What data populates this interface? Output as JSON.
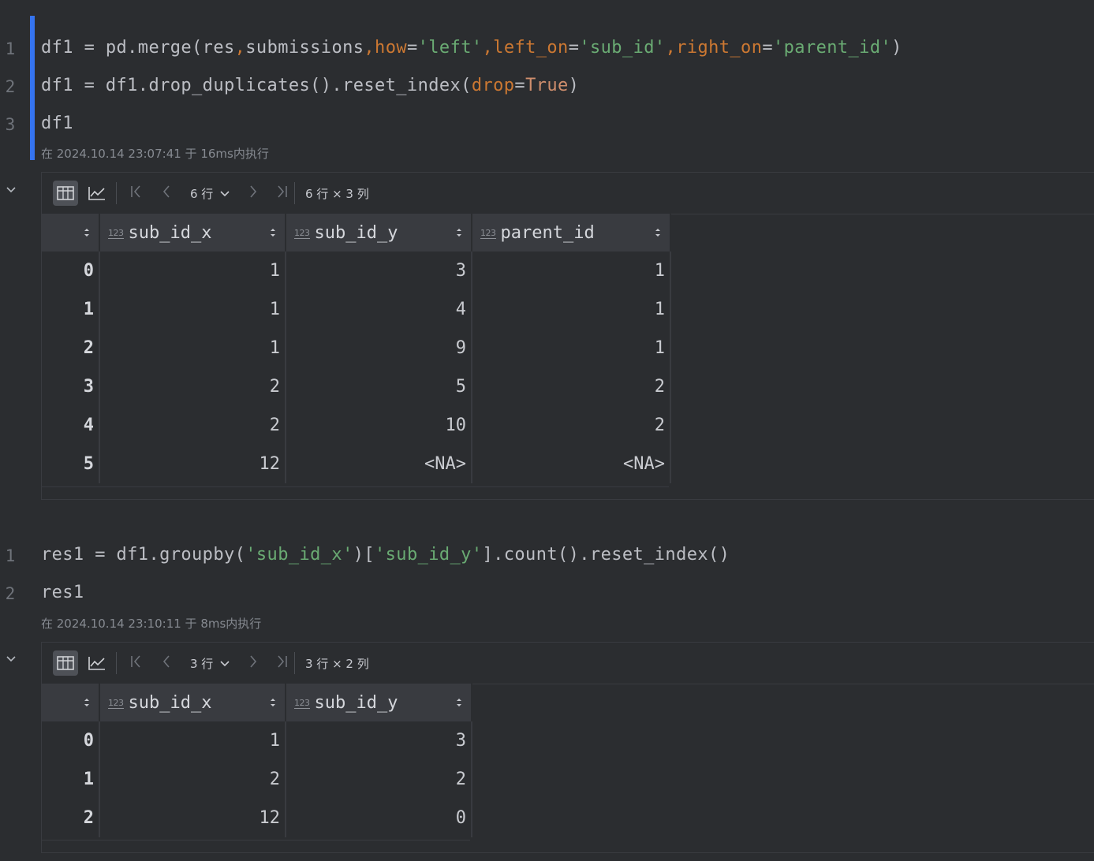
{
  "cells": [
    {
      "lines": [
        {
          "num": "1"
        },
        {
          "num": "2"
        },
        {
          "num": "3"
        }
      ],
      "exec_meta": "在 2024.10.14 23:07:41 于 16ms内执行",
      "output": {
        "rows_label": "6 行",
        "dims_label": "6 行 × 3 列",
        "columns": [
          {
            "name": "",
            "type": ""
          },
          {
            "name": "sub_id_x",
            "type": "123"
          },
          {
            "name": "sub_id_y",
            "type": "123"
          },
          {
            "name": "parent_id",
            "type": "123"
          }
        ],
        "rows": [
          [
            "0",
            "1",
            "3",
            "1"
          ],
          [
            "1",
            "1",
            "4",
            "1"
          ],
          [
            "2",
            "1",
            "9",
            "1"
          ],
          [
            "3",
            "2",
            "5",
            "2"
          ],
          [
            "4",
            "2",
            "10",
            "2"
          ],
          [
            "5",
            "12",
            "<NA>",
            "<NA>"
          ]
        ]
      }
    },
    {
      "lines": [
        {
          "num": "1"
        },
        {
          "num": "2"
        }
      ],
      "exec_meta": "在 2024.10.14 23:10:11 于 8ms内执行",
      "output": {
        "rows_label": "3 行",
        "dims_label": "3 行 × 2 列",
        "columns": [
          {
            "name": "",
            "type": ""
          },
          {
            "name": "sub_id_x",
            "type": "123"
          },
          {
            "name": "sub_id_y",
            "type": "123"
          }
        ],
        "rows": [
          [
            "0",
            "1",
            "3"
          ],
          [
            "1",
            "2",
            "2"
          ],
          [
            "2",
            "12",
            "0"
          ]
        ]
      }
    }
  ],
  "code": {
    "c1l1": [
      "df1 = pd.merge(res",
      ",",
      "submissions",
      ",",
      "how",
      "=",
      "'left'",
      ",",
      "left_on",
      "=",
      "'sub_id'",
      ",",
      "right_on",
      "=",
      "'parent_id'",
      ")"
    ],
    "c1l2": [
      "df1 = df1.drop_duplicates().reset_index(",
      "drop",
      "=",
      "True",
      ")"
    ],
    "c1l3": [
      "df1"
    ],
    "c2l1": [
      "res1 = df1.groupby(",
      "'sub_id_x'",
      ")[",
      "'sub_id_y'",
      "].count().reset_index()"
    ],
    "c2l2": [
      "res1"
    ]
  },
  "colors": {
    "accent": "#3574f0",
    "string": "#6aab73",
    "keyword": "#cf8e6d",
    "param": "#cc7832"
  },
  "icons": [
    "chevron-down-icon",
    "table-view-icon",
    "chart-view-icon",
    "first-page-icon",
    "prev-page-icon",
    "chevron-down-icon",
    "next-page-icon",
    "last-page-icon",
    "sort-icon",
    "number-type-icon"
  ]
}
